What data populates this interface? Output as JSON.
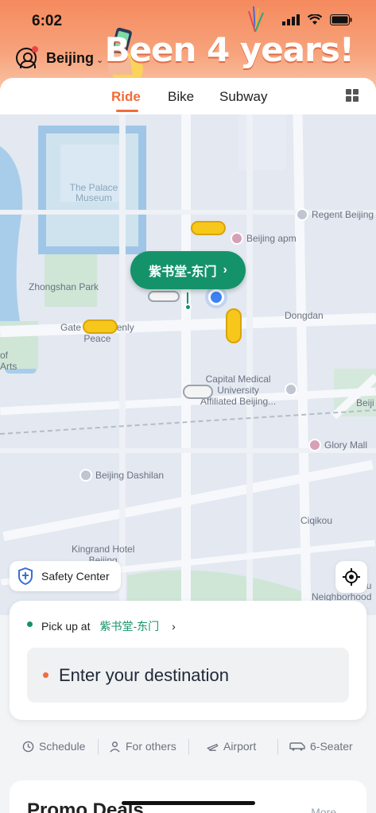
{
  "status_bar": {
    "time": "6:02"
  },
  "header": {
    "city": "Beijing",
    "banner_text": "Been 4 years!"
  },
  "tabs": [
    {
      "label": "Ride",
      "active": true
    },
    {
      "label": "Bike",
      "active": false
    },
    {
      "label": "Subway",
      "active": false
    }
  ],
  "map": {
    "labels": {
      "palace": "The Palace\nMuseum",
      "zhongshan": "Zhongshan Park",
      "gate": "Gate of Heavenly\nPeace",
      "arts": "of\nArts",
      "dongdan": "Dongdan",
      "regent": "Regent Beijing",
      "beijing_apm": "Beijing apm",
      "capital": "Capital Medical\nUniversity\nAffiliated Beijing...",
      "beiji": "Beiji",
      "glory": "Glory Mall",
      "dashilan": "Beijing Dashilan",
      "cíqikou": "Ciqikou",
      "kingrand": "Kingrand Hotel\nBeijing",
      "tiyu": "Tiyu\nNeighborhood"
    },
    "pickup_bubble": "紫书堂-东门",
    "safety_center": "Safety Center"
  },
  "booking": {
    "pickup_prefix": "Pick up at",
    "pickup_place": "紫书堂-东门",
    "destination_placeholder": "Enter your destination"
  },
  "quick_options": [
    {
      "label": "Schedule",
      "icon": "clock-icon"
    },
    {
      "label": "For others",
      "icon": "person-icon"
    },
    {
      "label": "Airport",
      "icon": "plane-icon"
    },
    {
      "label": "6-Seater",
      "icon": "van-icon"
    }
  ],
  "promo": {
    "title": "Promo Deals",
    "more": "More →"
  },
  "colors": {
    "brand_orange": "#f26b3a",
    "green": "#14936a"
  }
}
